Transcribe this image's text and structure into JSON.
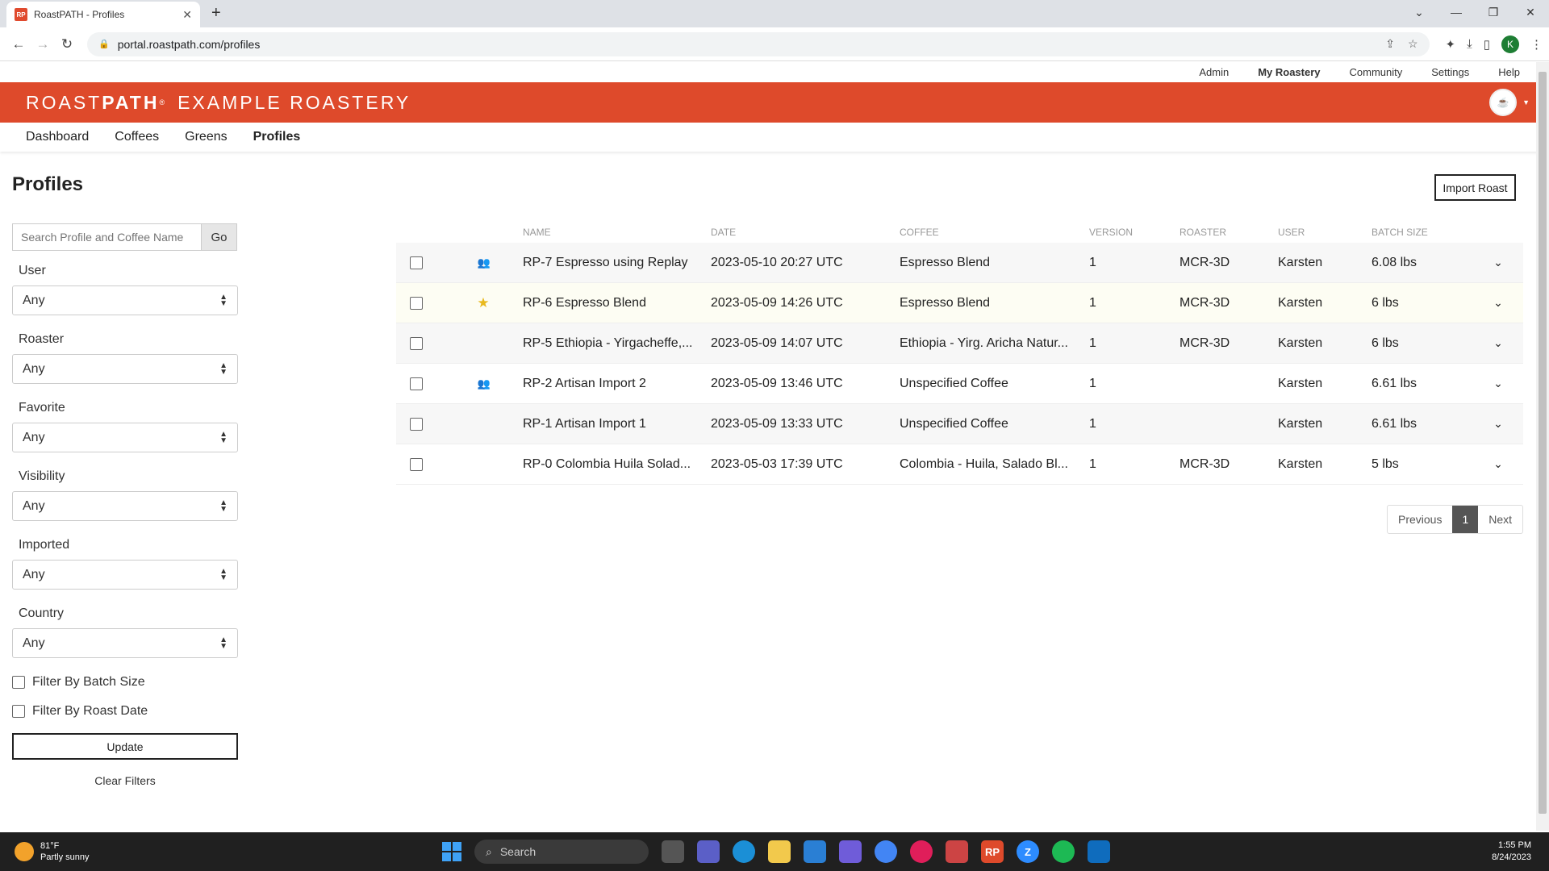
{
  "browser": {
    "tab_title": "RoastPATH - Profiles",
    "favicon_text": "RP",
    "url": "portal.roastpath.com/profiles",
    "profile_initial": "K"
  },
  "site": {
    "top_links": [
      "Admin",
      "My Roastery",
      "Community",
      "Settings",
      "Help"
    ],
    "brand_light": "ROAST",
    "brand_bold": "PATH",
    "brand_mark": "®",
    "org_name": "EXAMPLE ROASTERY",
    "nav": [
      "Dashboard",
      "Coffees",
      "Greens",
      "Profiles"
    ],
    "accent_color": "#de4a2b"
  },
  "page": {
    "title": "Profiles",
    "import_label": "Import Roast"
  },
  "filters": {
    "search_placeholder": "Search Profile and Coffee Name",
    "go_label": "Go",
    "user_label": "User",
    "user_value": "Any",
    "roaster_label": "Roaster",
    "roaster_value": "Any",
    "favorite_label": "Favorite",
    "favorite_value": "Any",
    "visibility_label": "Visibility",
    "visibility_value": "Any",
    "imported_label": "Imported",
    "imported_value": "Any",
    "country_label": "Country",
    "country_value": "Any",
    "batch_size_label": "Filter By Batch Size",
    "roast_date_label": "Filter By Roast Date",
    "update_label": "Update",
    "clear_label": "Clear Filters"
  },
  "table": {
    "headers": {
      "name": "NAME",
      "date": "DATE",
      "coffee": "COFFEE",
      "version": "VERSION",
      "roaster": "ROASTER",
      "user": "USER",
      "batch": "BATCH SIZE"
    },
    "rows": [
      {
        "icon": "shared",
        "name": "RP-7 Espresso using Replay",
        "date": "2023-05-10 20:27 UTC",
        "coffee": "Espresso Blend",
        "version": "1",
        "roaster": "MCR-3D",
        "user": "Karsten",
        "batch": "6.08 lbs"
      },
      {
        "icon": "favorite",
        "name": "RP-6 Espresso Blend",
        "date": "2023-05-09 14:26 UTC",
        "coffee": "Espresso Blend",
        "version": "1",
        "roaster": "MCR-3D",
        "user": "Karsten",
        "batch": "6 lbs"
      },
      {
        "icon": "",
        "name": "RP-5 Ethiopia - Yirgacheffe,...",
        "date": "2023-05-09 14:07 UTC",
        "coffee": "Ethiopia - Yirg. Aricha Natur...",
        "version": "1",
        "roaster": "MCR-3D",
        "user": "Karsten",
        "batch": "6 lbs"
      },
      {
        "icon": "shared",
        "name": "RP-2 Artisan Import 2",
        "date": "2023-05-09 13:46 UTC",
        "coffee": "Unspecified Coffee",
        "version": "1",
        "roaster": "",
        "user": "Karsten",
        "batch": "6.61 lbs"
      },
      {
        "icon": "",
        "name": "RP-1 Artisan Import 1",
        "date": "2023-05-09 13:33 UTC",
        "coffee": "Unspecified Coffee",
        "version": "1",
        "roaster": "",
        "user": "Karsten",
        "batch": "6.61 lbs"
      },
      {
        "icon": "",
        "name": "RP-0 Colombia Huila Solad...",
        "date": "2023-05-03 17:39 UTC",
        "coffee": "Colombia - Huila, Salado Bl...",
        "version": "1",
        "roaster": "MCR-3D",
        "user": "Karsten",
        "batch": "5 lbs"
      }
    ]
  },
  "pager": {
    "previous": "Previous",
    "current": "1",
    "next": "Next"
  },
  "taskbar": {
    "temp": "81°F",
    "weather": "Partly sunny",
    "search_label": "Search",
    "time": "1:55 PM",
    "date": "8/24/2023"
  }
}
